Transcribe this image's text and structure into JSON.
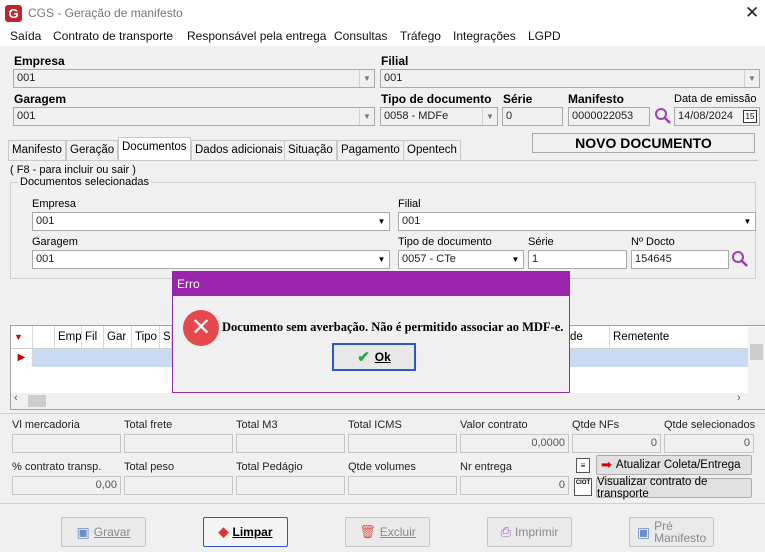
{
  "window": {
    "title": "CGS - Geração de manifesto",
    "logo_letter": "G"
  },
  "menu": [
    "Saída",
    "Contrato de transporte",
    "Responsável pela entrega",
    "Consultas",
    "Tráfego",
    "Integrações",
    "LGPD"
  ],
  "header": {
    "empresa": {
      "label": "Empresa",
      "value": "001"
    },
    "filial": {
      "label": "Filial",
      "value": "001"
    },
    "garagem": {
      "label": "Garagem",
      "value": "001"
    },
    "tipo_documento": {
      "label": "Tipo de documento",
      "value": "0058 - MDFe"
    },
    "serie": {
      "label": "Série",
      "value": "0"
    },
    "manifesto": {
      "label": "Manifesto",
      "value": "0000022053"
    },
    "data_emissao": {
      "label": "Data de emissão",
      "value": "14/08/2024",
      "cal": "15"
    }
  },
  "tabs": [
    "Manifesto",
    "Geração",
    "Documentos",
    "Dados adicionais",
    "Situação",
    "Pagamento",
    "Opentech"
  ],
  "status_banner": "NOVO DOCUMENTO",
  "documentos": {
    "hint": "( F8 - para incluir ou sair )",
    "group_title": "Documentos selecionadas",
    "empresa": {
      "label": "Empresa",
      "value": "001"
    },
    "filial": {
      "label": "Filial",
      "value": "001"
    },
    "garagem": {
      "label": "Garagem",
      "value": "001"
    },
    "tipo_documento": {
      "label": "Tipo de documento",
      "value": "0057 - CTe"
    },
    "serie": {
      "label": "Série",
      "value": "1"
    },
    "n_docto": {
      "label": "Nº Docto",
      "value": "154645"
    }
  },
  "grid": {
    "columns": [
      "Emp",
      "Fil",
      "Gar",
      "Tipo",
      "S",
      "de Frete",
      "Remetente"
    ]
  },
  "totals": {
    "row1": [
      {
        "label": "Vl mercadoria",
        "value": ""
      },
      {
        "label": "Total frete",
        "value": ""
      },
      {
        "label": "Total M3",
        "value": ""
      },
      {
        "label": "Total ICMS",
        "value": ""
      },
      {
        "label": "Valor contrato",
        "value": "0,0000"
      },
      {
        "label": "Qtde NFs",
        "value": "0"
      },
      {
        "label": "Qtde selecionados",
        "value": "0"
      }
    ],
    "row2": [
      {
        "label": "% contrato transp.",
        "value": "0,00"
      },
      {
        "label": "Total peso",
        "value": ""
      },
      {
        "label": "Total Pedágio",
        "value": ""
      },
      {
        "label": "Qtde volumes",
        "value": ""
      },
      {
        "label": "Nr entrega",
        "value": "0"
      }
    ]
  },
  "side_buttons": {
    "atualizar": "Atualizar Coleta/Entrega",
    "visualizar": "Visualizar contrato de transporte",
    "ciot_label": "CIOT"
  },
  "footer": {
    "gravar": "Gravar",
    "limpar": "Limpar",
    "excluir": "Excluir",
    "imprimir": "Imprimir",
    "pre_manifesto_1": "Pré",
    "pre_manifesto_2": "Manifesto"
  },
  "dialog": {
    "title": "Erro",
    "message": "Documento sem averbação. Não é permitido associar ao MDF-e.",
    "ok": "Ok"
  },
  "colors": {
    "dialog_title": "#9b24ac",
    "error_red": "#e5484d",
    "brand": "#c0272d",
    "ok_border": "#2a59c6"
  }
}
